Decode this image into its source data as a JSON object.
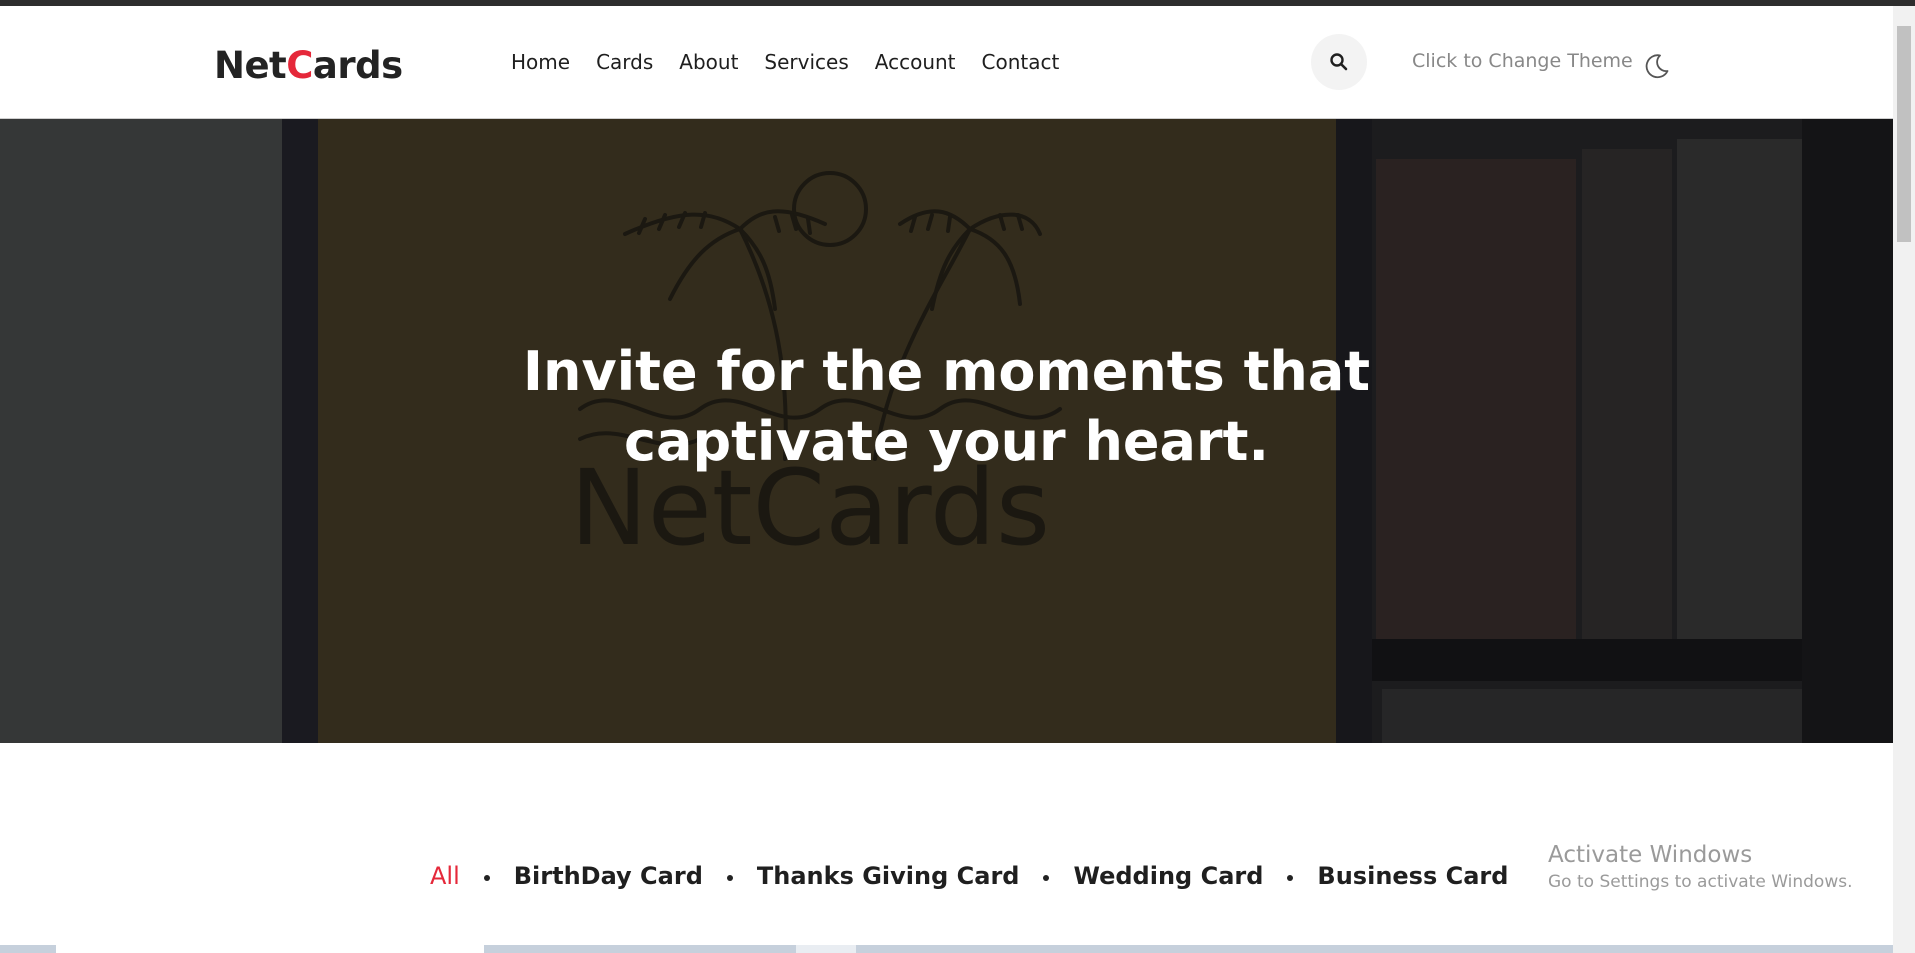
{
  "header": {
    "logo_part1": "Net",
    "logo_accent": "C",
    "logo_part2": "ards",
    "nav": [
      "Home",
      "Cards",
      "About",
      "Services",
      "Account",
      "Contact"
    ],
    "theme_label": "Click to Change Theme"
  },
  "hero": {
    "title_line1": "Invite for the moments that",
    "title_line2": "captivate your heart.",
    "art_logo_text": "NetCards"
  },
  "filters": {
    "items": [
      "All",
      "BirthDay Card",
      "Thanks Giving Card",
      "Wedding Card",
      "Business Card"
    ],
    "active": "All"
  },
  "watermark": {
    "line1": "Activate Windows",
    "line2": "Go to Settings to activate Windows."
  },
  "colors": {
    "accent": "#e5283a",
    "text": "#1f1f1f"
  },
  "icons": {
    "search": "search-icon",
    "theme": "moon-icon"
  }
}
